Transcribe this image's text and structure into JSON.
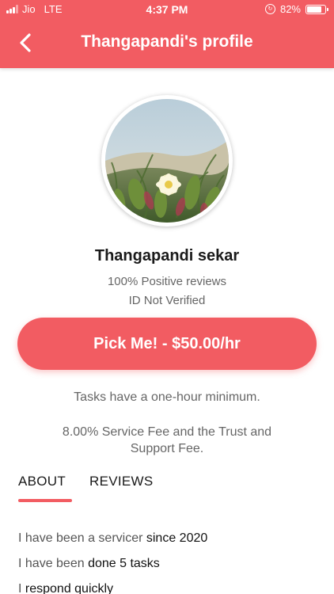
{
  "status_bar": {
    "carrier": "Jio",
    "network": "LTE",
    "time": "4:37 PM",
    "battery": "82%",
    "battery_level": 0.82
  },
  "header": {
    "title": "Thangapandi's profile"
  },
  "profile": {
    "name": "Thangapandi sekar",
    "reviews": "100% Positive reviews",
    "id_status": "ID Not Verified"
  },
  "cta": {
    "label": "Pick Me! - $50.00/hr"
  },
  "notes": {
    "minimum": "Tasks have a one-hour minimum.",
    "fee_line1": "8.00%  Service Fee and the Trust and",
    "fee_line2": "Support Fee."
  },
  "tabs": [
    {
      "label": "ABOUT",
      "active": true
    },
    {
      "label": "REVIEWS",
      "active": false
    }
  ],
  "about": [
    {
      "prefix": "I have been a servicer ",
      "value": "since 2020"
    },
    {
      "prefix": "I have been ",
      "value": "done 5 tasks"
    },
    {
      "prefix": "I ",
      "value": "respond quickly"
    }
  ],
  "colors": {
    "accent": "#f25c62"
  }
}
